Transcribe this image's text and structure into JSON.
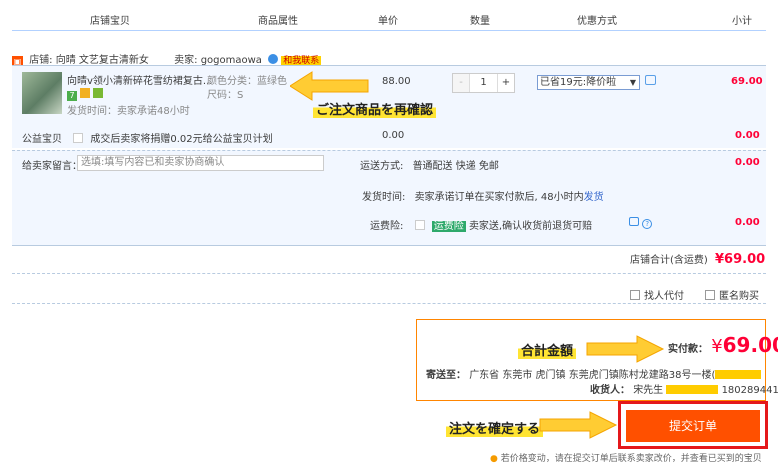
{
  "header": {
    "columns": [
      "店铺宝贝",
      "商品属性",
      "单价",
      "数量",
      "优惠方式",
      "小计"
    ]
  },
  "shop": {
    "prefix": "店铺:",
    "name": "向晴 文艺复古清新女",
    "seller_prefix": "卖家:",
    "seller_name": "gogomaowa",
    "contact_label": "和我联系"
  },
  "item": {
    "title": "向晴v领小清新碎花雪纺裙复古...",
    "ship_time": "发货时间：卖家承诺48小时",
    "color_label": "颜色分类：",
    "color_value": "蓝绿色",
    "size_label": "尺码：",
    "size_value": "S",
    "unit_price": "88.00",
    "quantity": "1",
    "qty_minus": "-",
    "qty_plus": "+",
    "discount_select": "已省19元:降价啦",
    "subtotal": "69.00"
  },
  "charity": {
    "label": "公益宝贝",
    "text": "成交后卖家将捐赠0.02元给公益宝贝计划",
    "price": "0.00",
    "subtotal": "0.00"
  },
  "message": {
    "label": "给卖家留言：",
    "placeholder": "选填:填写内容已和卖家协商确认"
  },
  "shipping": {
    "label": "运送方式:",
    "value": "普通配送 快递 免邮",
    "subtotal": "0.00",
    "time_label": "发货时间:",
    "time_value": "卖家承诺订单在买家付款后, 48小时内",
    "time_link": "发货"
  },
  "insurance": {
    "label": "运费险:",
    "badge": "运费险",
    "text": "卖家送,确认收货前退货可赔",
    "subtotal": "0.00"
  },
  "store_total": {
    "label": "店铺合计(含运费)",
    "value": "¥69.00"
  },
  "options": {
    "proxy_pay": "找人代付",
    "anonymous": "匿名购买"
  },
  "summary": {
    "paid_label": "实付款：",
    "currency": "¥",
    "paid_value": "69.00",
    "ship_to_label": "寄送至：",
    "address": "广东省 东莞市   虎门镇 东莞虎门镇陈村龙建路38号一楼(",
    "address_end": ")",
    "receiver_label": "收货人：",
    "receiver_name": "宋先生",
    "phone": "18028944119"
  },
  "submit": {
    "label": "提交订单",
    "notice": "若价格变动，请在提交订单后联系卖家改价，并查看已买到的宝贝"
  },
  "annotations": {
    "confirm_items": "ご注文商品を再確認",
    "total_amount": "合計金額",
    "confirm_order": "注文を確定する"
  },
  "colors": {
    "accent": "#ff5000",
    "price_red": "#ff0036",
    "highlight": "#ffe433",
    "arrow": "#ffcc33",
    "outline": "#e4181b"
  }
}
